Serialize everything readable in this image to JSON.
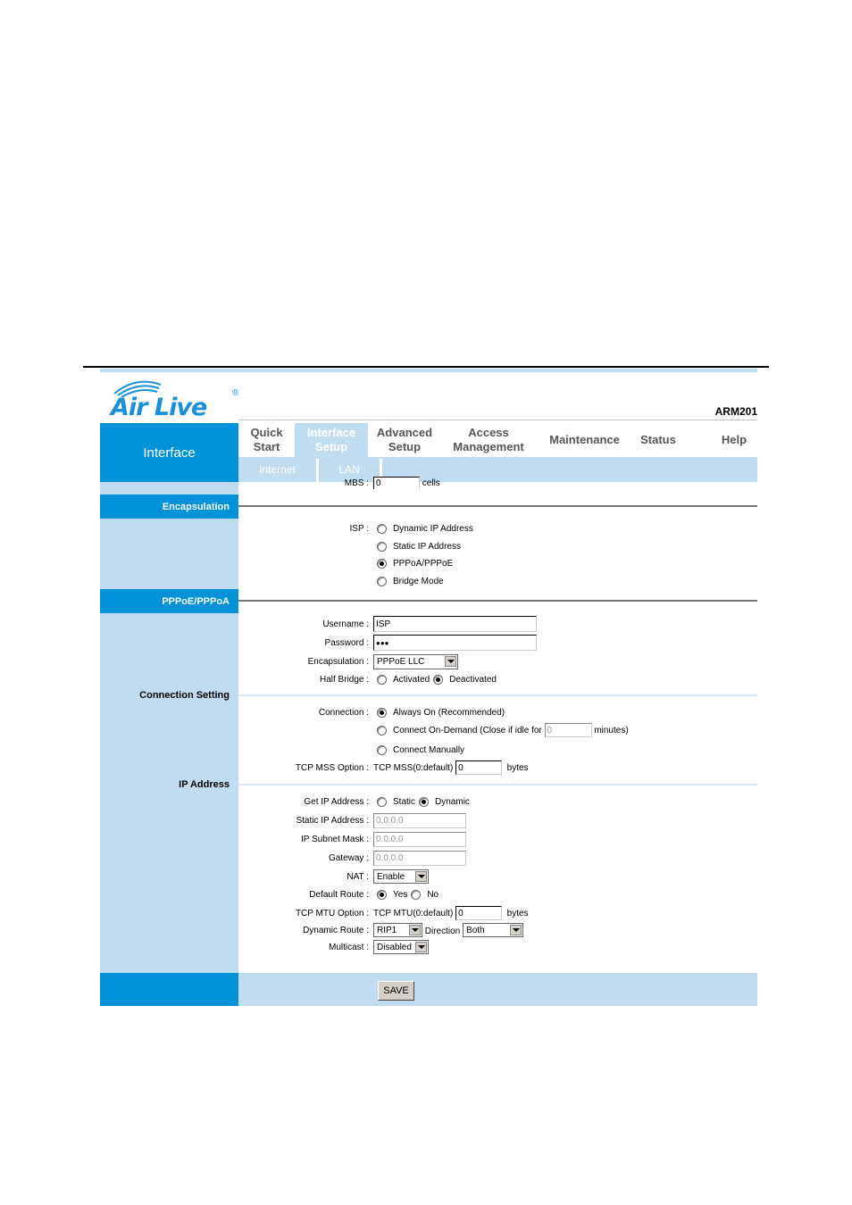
{
  "brand": {
    "name": "Air Live",
    "registered": "®",
    "model": "ARM201"
  },
  "sidebar": {
    "header": "Interface"
  },
  "nav": {
    "tabs": [
      {
        "line1": "Quick",
        "line2": "Start"
      },
      {
        "line1": "Interface",
        "line2": "Setup",
        "active": true
      },
      {
        "line1": "Advanced",
        "line2": "Setup"
      },
      {
        "line1": "Access",
        "line2": "Management"
      },
      {
        "line1": "Maintenance",
        "line2": ""
      },
      {
        "line1": "Status",
        "line2": ""
      },
      {
        "line1": "Help",
        "line2": ""
      }
    ],
    "subtabs": [
      "Internet",
      "LAN"
    ]
  },
  "mbs": {
    "label": "MBS :",
    "value": "0",
    "unit": "cells"
  },
  "sections": {
    "encapsulation": "Encapsulation",
    "pppoe": "PPPoE/PPPoA",
    "connection": "Connection Setting",
    "ip": "IP Address"
  },
  "isp": {
    "label": "ISP :",
    "options": [
      "Dynamic IP Address",
      "Static IP Address",
      "PPPoA/PPPoE",
      "Bridge Mode"
    ],
    "selected": "PPPoA/PPPoE"
  },
  "pppoe": {
    "username_label": "Username :",
    "username": "ISP",
    "password_label": "Password :",
    "password": "●●●",
    "encap_label": "Encapsulation :",
    "encap_value": "PPPoE LLC",
    "halfbridge_label": "Half Bridge :",
    "halfbridge_options": [
      "Activated",
      "Deactivated"
    ],
    "halfbridge_selected": "Deactivated"
  },
  "connection": {
    "label": "Connection :",
    "always_on": "Always On (Recommended)",
    "on_demand": "Connect On-Demand (Close if idle for",
    "idle_value": "0",
    "idle_unit": "minutes)",
    "manual": "Connect Manually",
    "selected": "Always On (Recommended)",
    "mss_label": "TCP MSS Option :",
    "mss_prefix": "TCP MSS(0:default)",
    "mss_value": "0",
    "mss_unit": "bytes"
  },
  "ip": {
    "get_label": "Get IP Address :",
    "get_options": [
      "Static",
      "Dynamic"
    ],
    "get_selected": "Dynamic",
    "static_ip_label": "Static IP Address :",
    "static_ip": "0.0.0.0",
    "subnet_label": "IP Subnet Mask :",
    "subnet": "0.0.0.0",
    "gateway_label": "Gateway :",
    "gateway": "0.0.0.0",
    "nat_label": "NAT :",
    "nat": "Enable",
    "default_route_label": "Default Route :",
    "default_route_options": [
      "Yes",
      "No"
    ],
    "default_route_selected": "Yes",
    "mtu_label": "TCP MTU Option :",
    "mtu_prefix": "TCP MTU(0:default)",
    "mtu_value": "0",
    "mtu_unit": "bytes",
    "dyn_route_label": "Dynamic Route :",
    "dyn_route": "RIP1",
    "direction_label": "Direction",
    "direction": "Both",
    "multicast_label": "Multicast :",
    "multicast": "Disabled"
  },
  "footer": {
    "save_label": "SAVE"
  },
  "colors": {
    "accent": "#0092d8",
    "light": "#c0dcf0"
  }
}
